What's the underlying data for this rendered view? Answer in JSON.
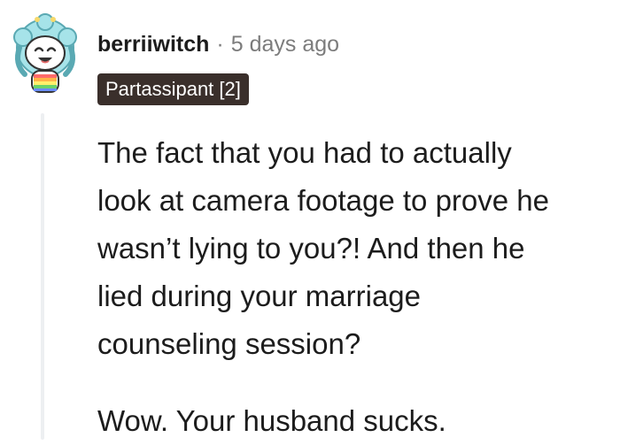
{
  "comment": {
    "author": "berriiwitch",
    "separator": "·",
    "timestamp": "5 days ago",
    "flair": "Partassipant [2]",
    "paragraphs": [
      {
        "lines": [
          "The fact that you had to actually",
          "look at camera footage to prove he",
          "wasn’t lying to you?! And then he",
          "lied during your marriage",
          "counseling session?"
        ]
      },
      {
        "lines": [
          "Wow. Your husband sucks."
        ]
      }
    ]
  },
  "icons": {
    "avatar": "snoo-avatar-icon"
  },
  "colors": {
    "text": "#1c1c1c",
    "meta": "#7c7c7c",
    "flair_bg": "#3a2f2b",
    "flair_text": "#ffffff",
    "thread_line": "#edeff1",
    "avatar_hair": "#a6e3e9",
    "avatar_accent": "#f6d96b"
  }
}
